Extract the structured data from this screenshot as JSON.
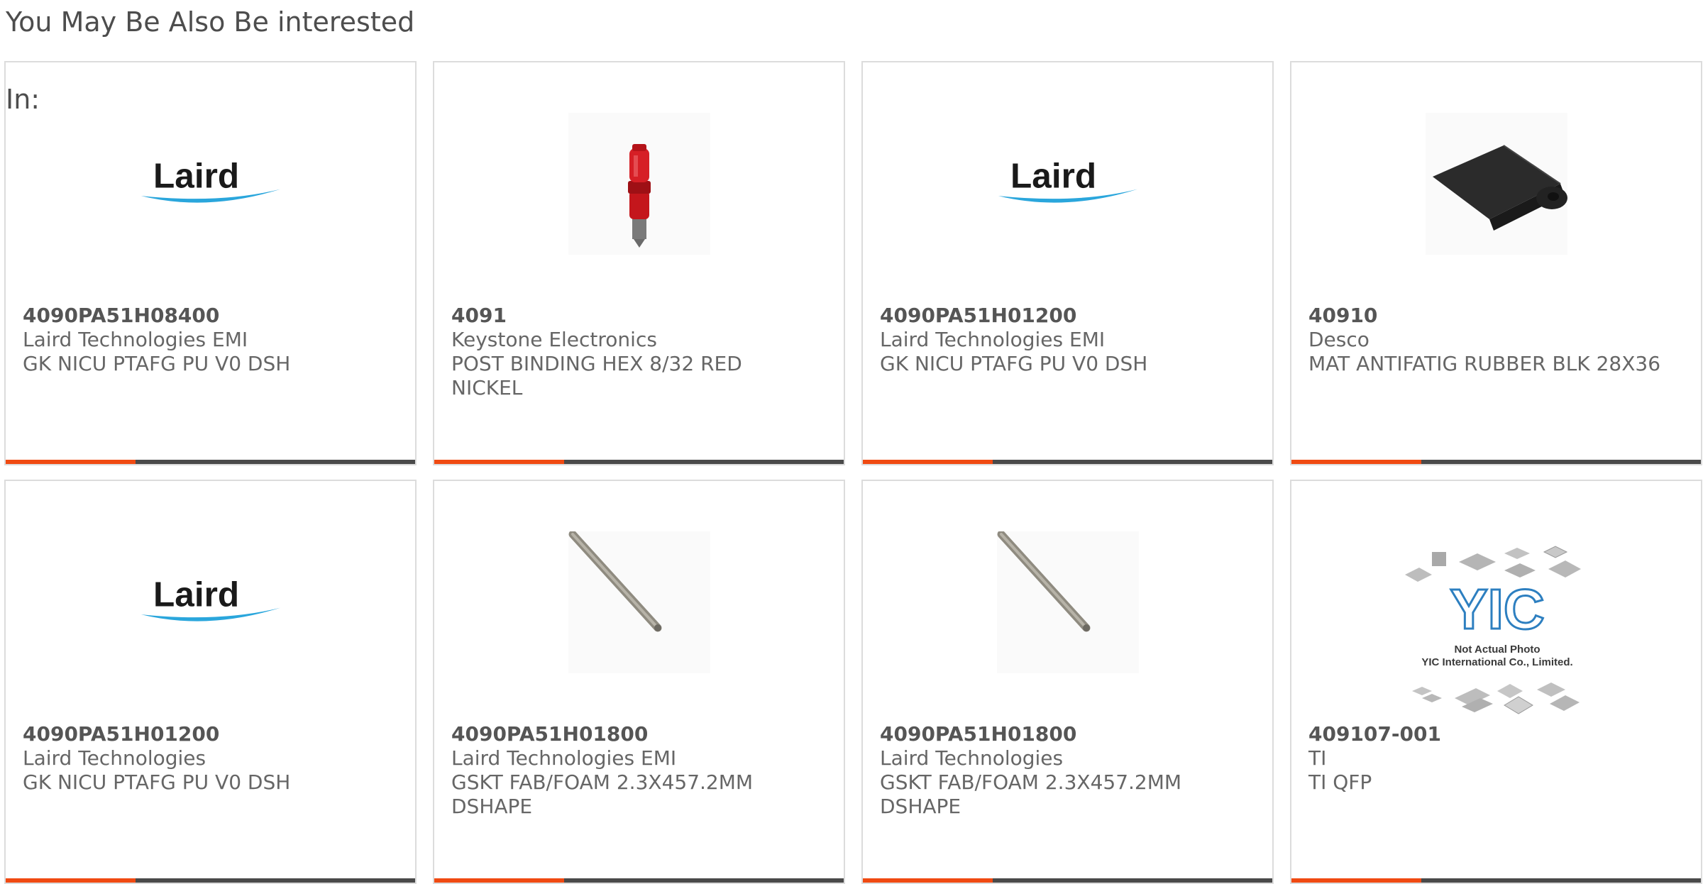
{
  "section": {
    "title": "You May Be Also Be interested",
    "title_continuation": "In:"
  },
  "colors": {
    "accent": "#f04a12",
    "bar": "#4a4a4a",
    "border": "#dcdcdc",
    "text": "#666666"
  },
  "products": [
    {
      "part_number": "4090PA51H08400",
      "manufacturer": "Laird Technologies EMI",
      "description": "GK NICU PTAFG PU V0 DSH",
      "image": "laird-logo",
      "logo_text": "Laird"
    },
    {
      "part_number": "4091",
      "manufacturer": "Keystone Electronics",
      "description": "POST BINDING HEX 8/32 RED NICKEL",
      "image": "red-binding-post"
    },
    {
      "part_number": "4090PA51H01200",
      "manufacturer": "Laird Technologies EMI",
      "description": "GK NICU PTAFG PU V0 DSH",
      "image": "laird-logo",
      "logo_text": "Laird"
    },
    {
      "part_number": "40910",
      "manufacturer": "Desco",
      "description": "MAT ANTIFATIG RUBBER BLK 28X36",
      "image": "rubber-mat-roll"
    },
    {
      "part_number": "4090PA51H01200",
      "manufacturer": "Laird Technologies",
      "description": "GK NICU PTAFG PU V0 DSH",
      "image": "laird-logo",
      "logo_text": "Laird"
    },
    {
      "part_number": "4090PA51H01800",
      "manufacturer": "Laird Technologies EMI",
      "description": "GSKT FAB/FOAM 2.3X457.2MM DSHAPE",
      "image": "gasket-rod"
    },
    {
      "part_number": "4090PA51H01800",
      "manufacturer": "Laird Technologies",
      "description": "GSKT FAB/FOAM 2.3X457.2MM DSHAPE",
      "image": "gasket-rod"
    },
    {
      "part_number": "409107-001",
      "manufacturer": "TI",
      "description": "TI QFP",
      "image": "yic-placeholder",
      "placeholder_line1": "Not Actual Photo",
      "placeholder_line2": "YIC International Co., Limited.",
      "placeholder_logo": "YIC"
    }
  ]
}
